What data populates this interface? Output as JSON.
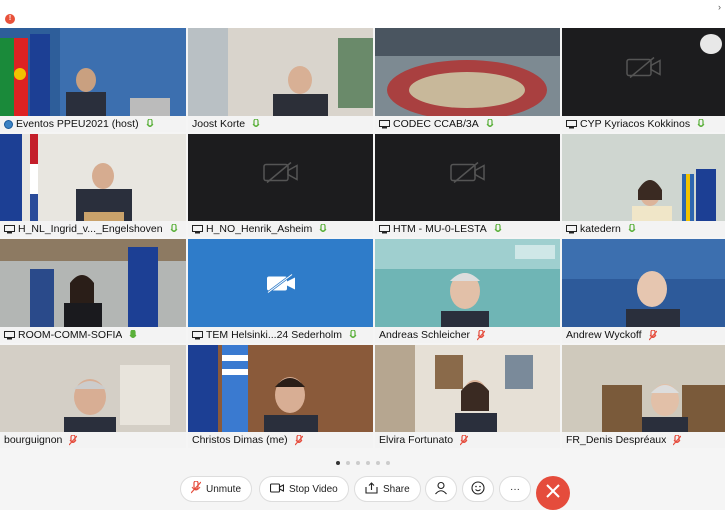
{
  "app": {
    "accent": "#9ad23a",
    "end_call_color": "#e54c3c"
  },
  "page": {
    "current_page": 1,
    "total_pages": 6
  },
  "participants": [
    {
      "name": "Eventos PPEU2021 (host)",
      "icon": "host-globe-icon",
      "mic": "on"
    },
    {
      "name": "Joost Korte",
      "icon": "none",
      "mic": "on"
    },
    {
      "name": "CODEC CCAB/3A",
      "icon": "monitor-icon",
      "mic": "on"
    },
    {
      "name": "CYP Kyriacos Kokkinos",
      "icon": "monitor-icon",
      "mic": "on"
    },
    {
      "name": "H_NL_Ingrid_v..._Engelshoven",
      "icon": "monitor-icon",
      "mic": "on"
    },
    {
      "name": "H_NO_Henrik_Asheim",
      "icon": "monitor-icon",
      "mic": "on"
    },
    {
      "name": "HTM - MU-0-LESTA",
      "icon": "monitor-icon",
      "mic": "on"
    },
    {
      "name": "katedern",
      "icon": "monitor-icon",
      "mic": "on"
    },
    {
      "name": "ROOM-COMM-SOFIA",
      "icon": "monitor-icon",
      "mic": "on",
      "active": true
    },
    {
      "name": "TEM Helsinki...24 Sederholm",
      "icon": "monitor-icon",
      "mic": "on"
    },
    {
      "name": "Andreas Schleicher",
      "icon": "none",
      "mic": "muted"
    },
    {
      "name": "Andrew Wyckoff",
      "icon": "none",
      "mic": "muted"
    },
    {
      "name": "bourguignon",
      "icon": "none",
      "mic": "muted"
    },
    {
      "name": "Christos Dimas (me)",
      "icon": "none",
      "mic": "muted"
    },
    {
      "name": "Elvira Fortunato",
      "icon": "none",
      "mic": "muted"
    },
    {
      "name": "FR_Denis Despréaux",
      "icon": "none",
      "mic": "muted"
    }
  ],
  "controls": {
    "unmute": "Unmute",
    "stop_video": "Stop Video",
    "share": "Share",
    "more": "···"
  }
}
